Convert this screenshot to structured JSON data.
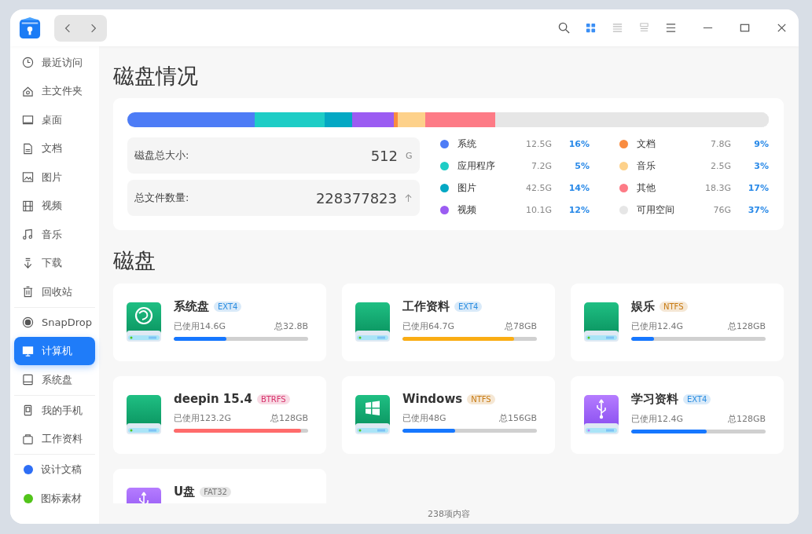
{
  "toolbar": {
    "views": [
      {
        "kind": "grid",
        "selected": true
      },
      {
        "kind": "list",
        "selected": false
      },
      {
        "kind": "tree",
        "selected": false
      }
    ]
  },
  "sidebar": {
    "groups": [
      {
        "items": [
          {
            "kind": "clock",
            "label": "最近访问",
            "selected": false
          },
          {
            "kind": "home",
            "label": "主文件夹",
            "selected": false
          },
          {
            "kind": "desktop",
            "label": "桌面",
            "selected": false
          },
          {
            "kind": "document",
            "label": "文档",
            "selected": false
          },
          {
            "kind": "image",
            "label": "图片",
            "selected": false
          },
          {
            "kind": "video",
            "label": "视频",
            "selected": false
          },
          {
            "kind": "music",
            "label": "音乐",
            "selected": false
          },
          {
            "kind": "download",
            "label": "下载",
            "selected": false
          },
          {
            "kind": "trash",
            "label": "回收站",
            "selected": false
          }
        ]
      },
      {
        "items": [
          {
            "kind": "radar",
            "label": "SnapDrop",
            "selected": false
          },
          {
            "kind": "computer",
            "label": "计算机",
            "selected": true
          },
          {
            "kind": "drive",
            "label": "系统盘",
            "selected": false
          }
        ]
      },
      {
        "items": [
          {
            "kind": "phone",
            "label": "我的手机",
            "selected": false
          },
          {
            "kind": "bag",
            "label": "工作资料",
            "selected": false
          }
        ]
      },
      {
        "items": [
          {
            "kind": "tag",
            "label": "设计文稿",
            "color": "#2e6ef5",
            "selected": false
          },
          {
            "kind": "tag",
            "label": "图标素材",
            "color": "#52c41a",
            "selected": false
          }
        ]
      }
    ]
  },
  "overview": {
    "title": "磁盘情况",
    "stats": [
      {
        "label": "磁盘总大小:",
        "value": "512",
        "unit": "G"
      },
      {
        "label": "总文件数量:",
        "value": "228377823",
        "arrow": true
      }
    ],
    "legend": [
      {
        "name": "系统",
        "size": "12.5G",
        "percent": "16%",
        "color": "#4d7cf6",
        "level": 0.199
      },
      {
        "name": "应用程序",
        "size": "7.2G",
        "percent": "5%",
        "color": "#1ecdc6",
        "level": 0.108
      },
      {
        "name": "图片",
        "size": "42.5G",
        "percent": "14%",
        "color": "#04a8c4",
        "level": 0.043
      },
      {
        "name": "视频",
        "size": "10.1G",
        "percent": "12%",
        "color": "#9b5cf2",
        "level": 0.065
      },
      {
        "name": "文档",
        "size": "7.8G",
        "percent": "9%",
        "color": "#f98c40",
        "level": 0.007
      },
      {
        "name": "音乐",
        "size": "2.5G",
        "percent": "3%",
        "color": "#fdd18a",
        "level": 0.043
      },
      {
        "name": "其他",
        "size": "18.3G",
        "percent": "17%",
        "color": "#fd7b86",
        "level": 0.108
      },
      {
        "name": "可用空间",
        "size": "76G",
        "percent": "37%",
        "color": "#e6e6e6",
        "level": 0.427
      }
    ]
  },
  "disks": {
    "title": "磁盘",
    "items": [
      {
        "kind": "deepin-drive",
        "name": "系统盘",
        "tag": {
          "text": "EXT4",
          "color": "#2b8de0"
        },
        "used": "已使用14.6G",
        "total": "总32.8B",
        "level": 0.39,
        "color": "#1677ff"
      },
      {
        "kind": "drive",
        "name": "工作资料",
        "tag": {
          "text": "EXT4",
          "color": "#2b8de0"
        },
        "used": "已使用64.7G",
        "total": "总78GB",
        "level": 0.83,
        "color": "#faad14"
      },
      {
        "kind": "drive",
        "name": "娱乐",
        "tag": {
          "text": "NTFS",
          "color": "#c77a12"
        },
        "used": "已使用12.4G",
        "total": "总128GB",
        "level": 0.17,
        "color": "#1677ff"
      },
      {
        "kind": "drive",
        "name": "deepin 15.4",
        "tag": {
          "text": "BTRFS",
          "color": "#d6336c"
        },
        "used": "已使用123.2G",
        "total": "总128GB",
        "level": 0.95,
        "color": "#ff6b6b"
      },
      {
        "kind": "windows-drive",
        "name": "Windows",
        "tag": {
          "text": "NTFS",
          "color": "#c77a12"
        },
        "used": "已使用48G",
        "total": "总156GB",
        "level": 0.39,
        "color": "#1677ff"
      },
      {
        "kind": "usb-drive",
        "name": "学习资料",
        "tag": {
          "text": "EXT4",
          "color": "#2b8de0"
        },
        "used": "已使用12.4G",
        "total": "总128GB",
        "level": 0.56,
        "color": "#1677ff"
      },
      {
        "kind": "usb-drive",
        "name": "U盘",
        "tag": {
          "text": "FAT32",
          "color": "#777777"
        }
      }
    ]
  },
  "status_bar": {
    "text": "238项内容"
  }
}
